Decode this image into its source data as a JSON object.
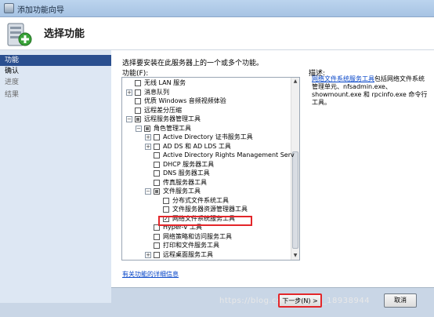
{
  "window": {
    "title": "添加功能向导"
  },
  "header": {
    "title": "选择功能"
  },
  "nav": {
    "items": [
      {
        "label": "功能",
        "state": "active"
      },
      {
        "label": "确认",
        "state": "normal"
      },
      {
        "label": "进度",
        "state": "dim"
      },
      {
        "label": "结果",
        "state": "dim"
      }
    ]
  },
  "content": {
    "instruction": "选择要安装在此服务器上的一个或多个功能。",
    "features_label": "功能(F):",
    "tree": [
      {
        "label": "无线 LAN 服务",
        "expander": "",
        "check": "",
        "indent": 0
      },
      {
        "label": "消息队列",
        "expander": "+",
        "check": "",
        "indent": 0
      },
      {
        "label": "优质 Windows 音频视频体验",
        "expander": "",
        "check": "",
        "indent": 0
      },
      {
        "label": "远程差分压缩",
        "expander": "",
        "check": "",
        "indent": 0
      },
      {
        "label": "远程服务器管理工具",
        "expander": "-",
        "check": "partial",
        "indent": 0
      },
      {
        "label": "角色管理工具",
        "expander": "-",
        "check": "partial",
        "indent": 1
      },
      {
        "label": "Active Directory 证书服务工具",
        "expander": "+",
        "check": "",
        "indent": 2
      },
      {
        "label": "AD DS 和 AD LDS 工具",
        "expander": "+",
        "check": "",
        "indent": 2
      },
      {
        "label": "Active Directory Rights Management Serv",
        "expander": "",
        "check": "",
        "indent": 2
      },
      {
        "label": "DHCP 服务器工具",
        "expander": "",
        "check": "",
        "indent": 2
      },
      {
        "label": "DNS 服务器工具",
        "expander": "",
        "check": "",
        "indent": 2
      },
      {
        "label": "传真服务器工具",
        "expander": "",
        "check": "",
        "indent": 2
      },
      {
        "label": "文件服务工具",
        "expander": "-",
        "check": "partial",
        "indent": 2
      },
      {
        "label": "分布式文件系统工具",
        "expander": "",
        "check": "",
        "indent": 3
      },
      {
        "label": "文件服务器资源管理器工具",
        "expander": "",
        "check": "",
        "indent": 3
      },
      {
        "label": "网络文件系统服务工具",
        "expander": "",
        "check": "checked",
        "indent": 3
      },
      {
        "label": "Hyper-V 工具",
        "expander": "",
        "check": "",
        "indent": 2
      },
      {
        "label": "网络策略和访问服务工具",
        "expander": "",
        "check": "",
        "indent": 2
      },
      {
        "label": "打印和文件服务工具",
        "expander": "",
        "check": "",
        "indent": 2
      },
      {
        "label": "远程桌面服务工具",
        "expander": "+",
        "check": "",
        "indent": 2
      }
    ],
    "more_info_link": "有关功能的详细信息"
  },
  "description": {
    "title": "描述:",
    "link_text": "网络文件系统服务工具",
    "body": "包括网络文件系统管理单元、nfsadmin.exe、showmount.exe 和 rpcinfo.exe 命令行工具。"
  },
  "buttons": {
    "next": "下一步(N) >",
    "cancel": "取消"
  },
  "watermark": "https://blog.csdn.net/qq_18938944"
}
